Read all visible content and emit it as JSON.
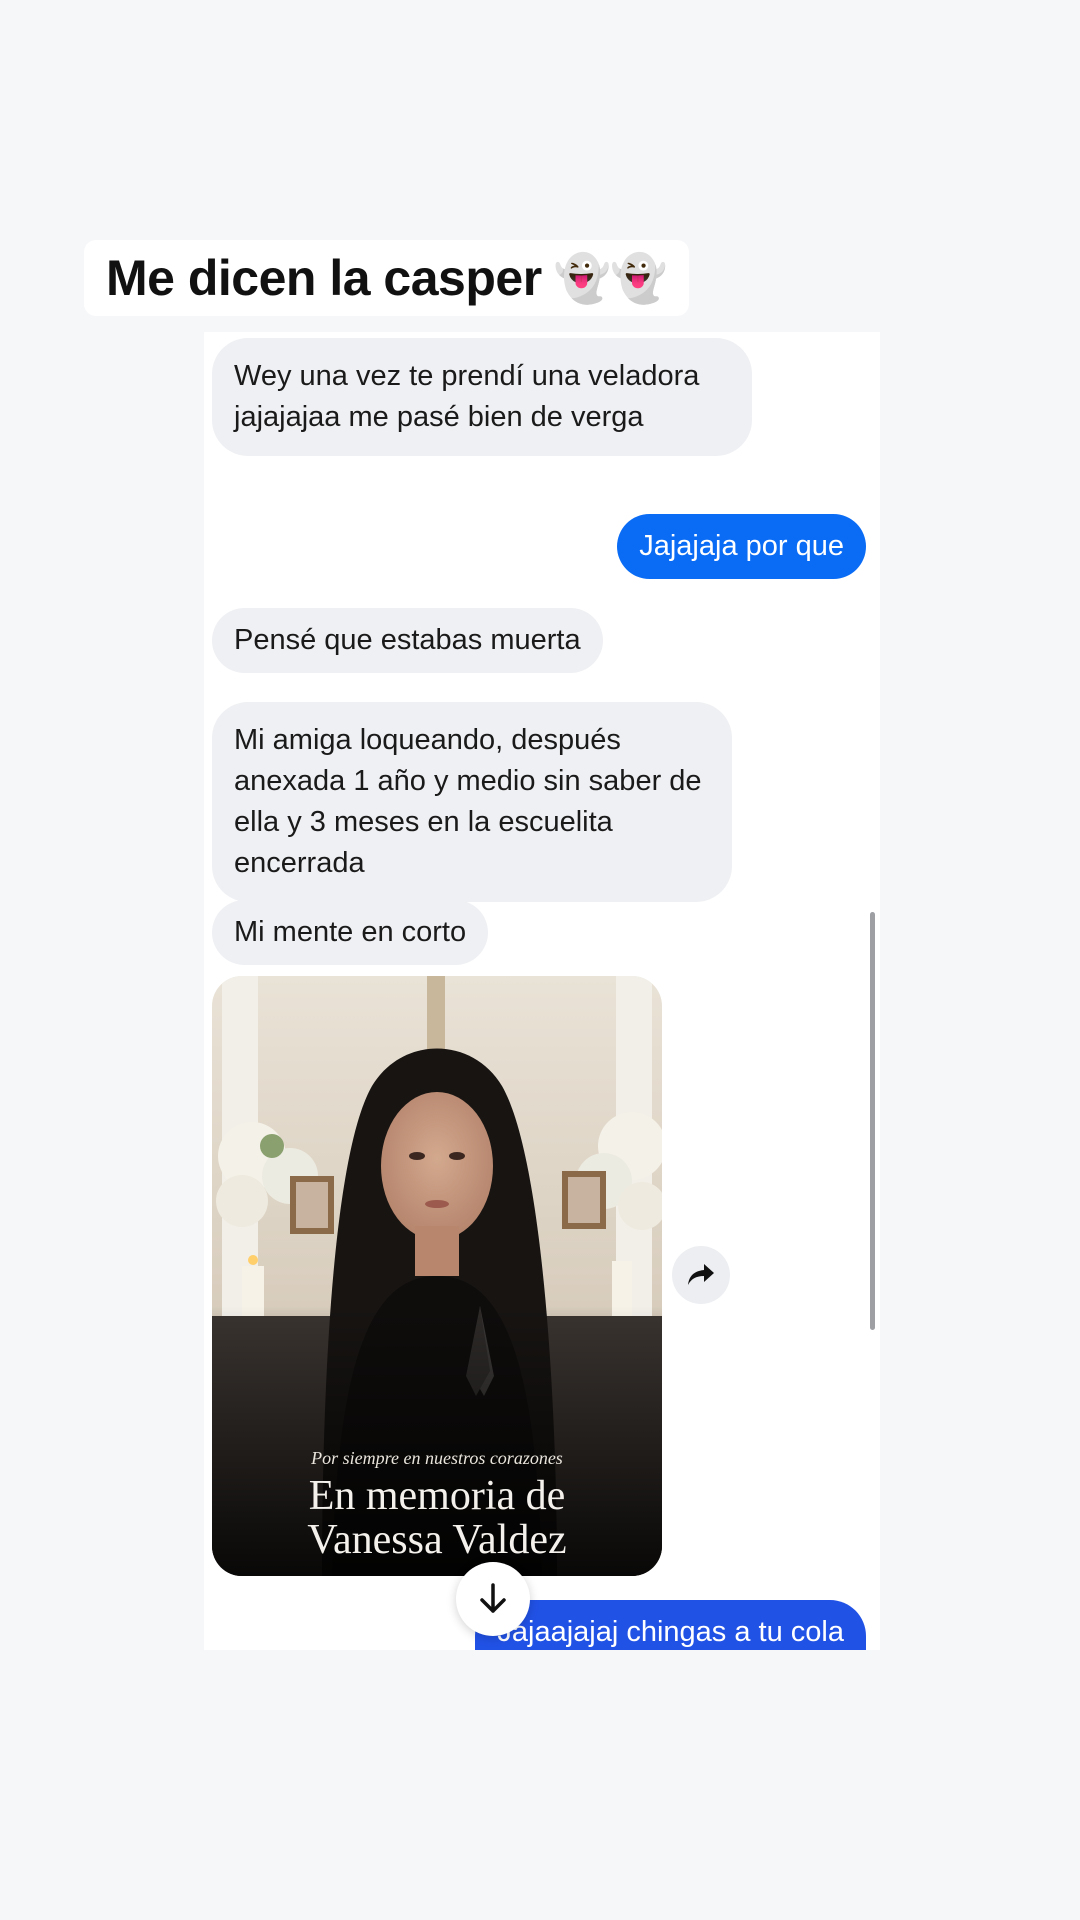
{
  "caption": {
    "text": "Me dicen la casper",
    "emoji": "👻👻"
  },
  "messages": [
    {
      "id": "m1",
      "direction": "incoming",
      "text": "Wey una vez te prendí una veladora jajajajaa me pasé bien de verga"
    },
    {
      "id": "m2",
      "direction": "outgoing",
      "text": "Jajajaja por que"
    },
    {
      "id": "m3",
      "direction": "incoming",
      "text": "Pensé que estabas muerta"
    },
    {
      "id": "m4",
      "direction": "incoming",
      "text": "Mi amiga loqueando, después anexada 1 año y medio sin saber de ella y 3  meses en la escuelita encerrada"
    },
    {
      "id": "m5",
      "direction": "incoming",
      "text": "Mi mente en corto"
    },
    {
      "id": "m6",
      "direction": "incoming",
      "type": "image",
      "image_text": {
        "line1": "Por siempre en nuestros corazones",
        "line2": "En memoria de",
        "line3": "Vanessa Valdez"
      }
    },
    {
      "id": "m7",
      "direction": "outgoing",
      "text": "Jajaajajaj chingas a tu cola"
    }
  ],
  "icons": {
    "share": "share-arrow-icon",
    "scroll_down": "arrow-down-icon"
  },
  "colors": {
    "outgoing_bubble": "#0a6cf5",
    "incoming_bubble": "#eff0f3",
    "background": "#f6f7f9"
  }
}
